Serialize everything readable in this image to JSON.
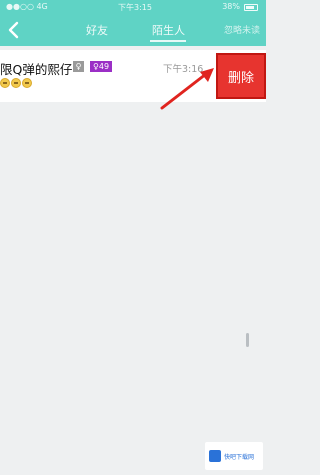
{
  "status_bar": {
    "carrier": "●●○○ 4G",
    "time": "下午3:15",
    "battery": "38%"
  },
  "nav": {
    "back_icon": "chevron-left-icon",
    "tabs": [
      {
        "label": "好友",
        "active": false
      },
      {
        "label": "陌生人",
        "active": true
      }
    ],
    "right_label": "忽略未读"
  },
  "chat": {
    "name": "限Q弹的熙仔",
    "gender_badge": "♀",
    "age_badge": "♀49",
    "time": "下午3:16",
    "emoji_count": 3,
    "swipe_action_label": "删除"
  },
  "watermark": {
    "text": "快吧下载网"
  },
  "colors": {
    "header": "#5fd3c5",
    "delete": "#e7342f",
    "age_badge": "#9b2fc6",
    "arrow": "#e0241f"
  }
}
